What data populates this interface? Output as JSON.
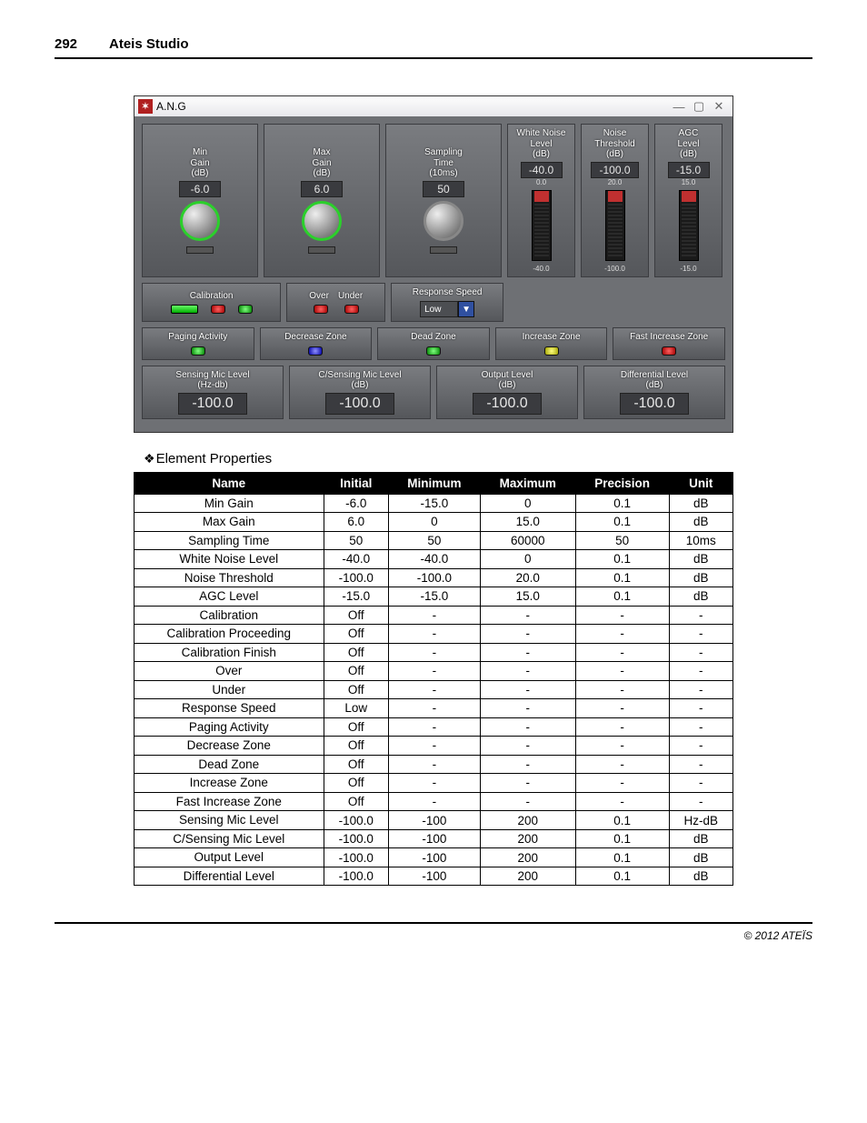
{
  "page": {
    "number": "292",
    "title": "Ateis Studio"
  },
  "window": {
    "title": "A.N.G",
    "row1": {
      "min_gain": {
        "label": "Min\nGain\n(dB)",
        "value": "-6.0"
      },
      "max_gain": {
        "label": "Max\nGain\n(dB)",
        "value": "6.0"
      },
      "sampling": {
        "label": "Sampling\nTime\n(10ms)",
        "value": "50"
      },
      "white_noise": {
        "label": "White Noise\nLevel\n(dB)",
        "value": "-40.0",
        "top": "0.0",
        "bot": "-40.0"
      },
      "noise_thr": {
        "label": "Noise\nThreshold\n(dB)",
        "value": "-100.0",
        "top": "20.0",
        "bot": "-100.0"
      },
      "agc": {
        "label": "AGC\nLevel\n(dB)",
        "value": "-15.0",
        "top": "15.0",
        "bot": "-15.0"
      }
    },
    "row2": {
      "calibration_label": "Calibration",
      "over_label": "Over",
      "under_label": "Under",
      "response_label": "Response Speed",
      "response_value": "Low"
    },
    "row3": {
      "paging": "Paging Activity",
      "decrease": "Decrease Zone",
      "dead": "Dead Zone",
      "increase": "Increase Zone",
      "fast": "Fast Increase Zone"
    },
    "row4": {
      "sensing": {
        "label": "Sensing Mic Level\n(Hz-db)",
        "value": "-100.0"
      },
      "csensing": {
        "label": "C/Sensing Mic Level\n(dB)",
        "value": "-100.0"
      },
      "output": {
        "label": "Output Level\n(dB)",
        "value": "-100.0"
      },
      "diff": {
        "label": "Differential Level\n(dB)",
        "value": "-100.0"
      }
    }
  },
  "section_heading": "Element Properties",
  "table": {
    "headers": [
      "Name",
      "Initial",
      "Minimum",
      "Maximum",
      "Precision",
      "Unit"
    ],
    "rows": [
      [
        "Min Gain",
        "-6.0",
        "-15.0",
        "0",
        "0.1",
        "dB"
      ],
      [
        "Max Gain",
        "6.0",
        "0",
        "15.0",
        "0.1",
        "dB"
      ],
      [
        "Sampling Time",
        "50",
        "50",
        "60000",
        "50",
        "10ms"
      ],
      [
        "White Noise Level",
        "-40.0",
        "-40.0",
        "0",
        "0.1",
        "dB"
      ],
      [
        "Noise Threshold",
        "-100.0",
        "-100.0",
        "20.0",
        "0.1",
        "dB"
      ],
      [
        "AGC Level",
        "-15.0",
        "-15.0",
        "15.0",
        "0.1",
        "dB"
      ],
      [
        "Calibration",
        "Off",
        "-",
        "-",
        "-",
        "-"
      ],
      [
        "Calibration Proceeding",
        "Off",
        "-",
        "-",
        "-",
        "-"
      ],
      [
        "Calibration Finish",
        "Off",
        "-",
        "-",
        "-",
        "-"
      ],
      [
        "Over",
        "Off",
        "-",
        "-",
        "-",
        "-"
      ],
      [
        "Under",
        "Off",
        "-",
        "-",
        "-",
        "-"
      ],
      [
        "Response Speed",
        "Low",
        "-",
        "-",
        "-",
        "-"
      ],
      [
        "Paging Activity",
        "Off",
        "-",
        "-",
        "-",
        "-"
      ],
      [
        "Decrease Zone",
        "Off",
        "-",
        "-",
        "-",
        "-"
      ],
      [
        "Dead Zone",
        "Off",
        "-",
        "-",
        "-",
        "-"
      ],
      [
        "Increase Zone",
        "Off",
        "-",
        "-",
        "-",
        "-"
      ],
      [
        "Fast Increase Zone",
        "Off",
        "-",
        "-",
        "-",
        "-"
      ],
      [
        "Sensing Mic Level",
        "-100.0",
        "-100",
        "200",
        "0.1",
        "Hz-dB"
      ],
      [
        "C/Sensing Mic Level",
        "-100.0",
        "-100",
        "200",
        "0.1",
        "dB"
      ],
      [
        "Output Level",
        "-100.0",
        "-100",
        "200",
        "0.1",
        "dB"
      ],
      [
        "Differential Level",
        "-100.0",
        "-100",
        "200",
        "0.1",
        "dB"
      ]
    ]
  },
  "footer": "© 2012 ATEÏS"
}
